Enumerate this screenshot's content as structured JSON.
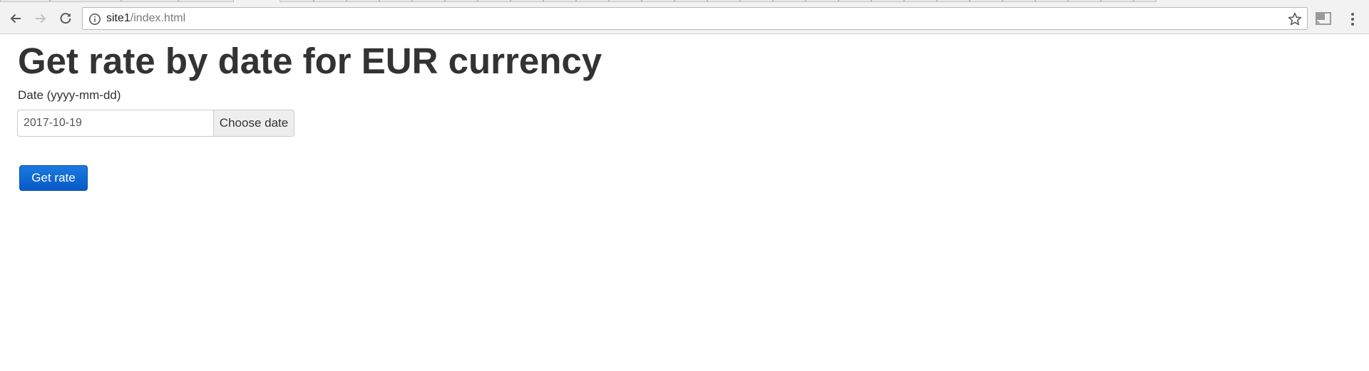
{
  "browser": {
    "url_host": "site1",
    "url_path": "/index.html"
  },
  "page": {
    "title": "Get rate by date for EUR currency",
    "date_label": "Date (yyyy-mm-dd)",
    "date_value": "2017-10-19",
    "choose_date_label": "Choose date",
    "get_rate_label": "Get rate"
  },
  "icons": {
    "back": "arrow-left",
    "forward": "arrow-right",
    "reload": "reload",
    "info": "info-circle",
    "bookmark": "star-outline",
    "cast": "cast",
    "menu": "vertical-ellipsis"
  },
  "colors": {
    "primary_button": "#0759c7",
    "title_text": "#333333",
    "addon_background": "#eeeeee"
  }
}
